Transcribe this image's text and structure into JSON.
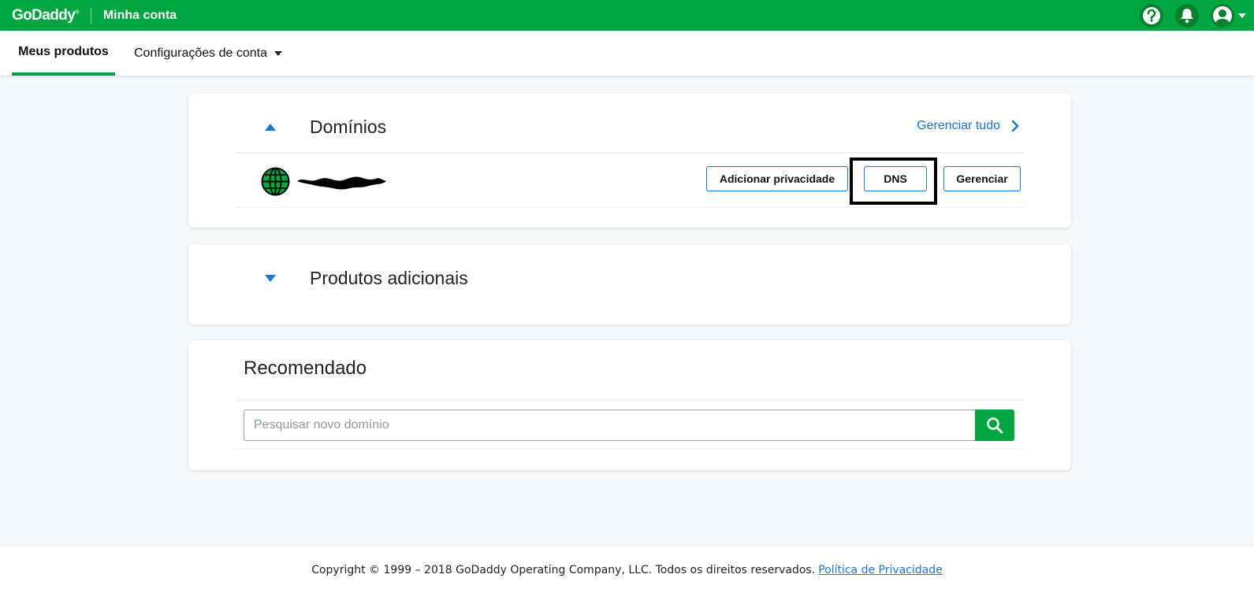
{
  "header": {
    "logo_text": "GoDaddy",
    "app_title": "Minha conta",
    "icons": [
      "help-icon",
      "bell-icon",
      "user-icon"
    ],
    "brand_color": "#00a63f"
  },
  "nav": {
    "tabs": [
      {
        "label": "Meus produtos",
        "active": true
      },
      {
        "label": "Configurações de conta",
        "active": false
      }
    ]
  },
  "domains": {
    "title": "Domínios",
    "manage_all": "Gerenciar tudo",
    "buttons": {
      "privacy": "Adicionar privacidade",
      "dns": "DNS",
      "manage": "Gerenciar"
    }
  },
  "additional": {
    "title": "Produtos adicionais"
  },
  "recommended": {
    "title": "Recomendado",
    "search_placeholder": "Pesquisar novo domínio"
  },
  "footer": {
    "copyright": "Copyright © 1999 – 2018 GoDaddy Operating Company, LLC. Todos os direitos reservados.",
    "privacy_link": "Política de Privacidade"
  }
}
